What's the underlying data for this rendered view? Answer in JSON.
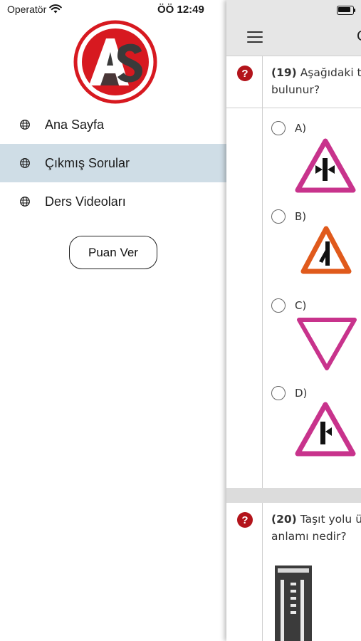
{
  "status": {
    "carrier": "Operatör",
    "time": "ÖÖ 12:49"
  },
  "drawer": {
    "logo_text": "AS",
    "menu": [
      {
        "label": "Ana Sayfa",
        "icon": "globe-icon",
        "active": false
      },
      {
        "label": "Çıkmış Sorular",
        "icon": "globe-icon",
        "active": true
      },
      {
        "label": "Ders Videoları",
        "icon": "globe-icon",
        "active": false
      }
    ],
    "rate_button": "Puan Ver"
  },
  "panel": {
    "title_partial": "Ç",
    "questions": [
      {
        "number": "(19)",
        "text_line1": "Aşağıdaki tr",
        "text_line2": "bulunur?",
        "options": [
          {
            "label": "A)",
            "sign": "merge-right-triangle-magenta"
          },
          {
            "label": "B)",
            "sign": "merge-left-triangle-orange"
          },
          {
            "label": "C)",
            "sign": "yield-inverted-triangle-magenta"
          },
          {
            "label": "D)",
            "sign": "merge-right-triangle-magenta"
          }
        ]
      },
      {
        "number": "(20)",
        "text_line1": "Taşıt yolu ü",
        "text_line2": "anlamı nedir?"
      }
    ]
  },
  "colors": {
    "active_menu_bg": "#cfdde6",
    "question_badge": "#b3141b",
    "sign_magenta": "#c8338c",
    "sign_orange": "#e05a1c"
  }
}
